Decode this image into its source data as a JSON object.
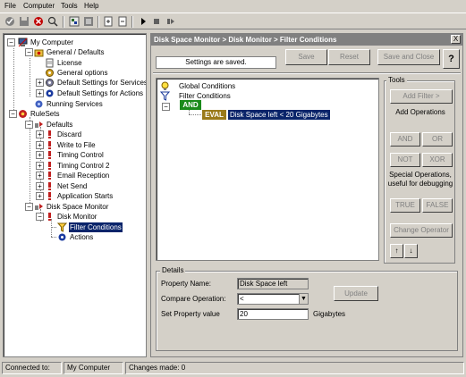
{
  "menu": {
    "file": "File",
    "computer": "Computer",
    "tools": "Tools",
    "help": "Help"
  },
  "toolbar": {
    "icons": [
      "check-icon",
      "save-icon",
      "delete-icon",
      "search-icon",
      "tree-icon",
      "print-icon",
      "export-icon",
      "import-icon",
      "play-icon",
      "stop-icon",
      "step-icon"
    ]
  },
  "tree": {
    "root": "My Computer",
    "general": "General / Defaults",
    "license": "License",
    "general_options": "General options",
    "default_services": "Default Settings for Services",
    "default_actions": "Default Settings for Actions",
    "running_services": "Running Services",
    "rulesets": "RuleSets",
    "defaults": "Defaults",
    "discard": "Discard",
    "write_file": "Write to File",
    "timing1": "Timing Control",
    "timing2": "Timing Control 2",
    "email": "Email Reception",
    "netsend": "Net Send",
    "appstarts": "Application Starts",
    "dsm": "Disk Space Monitor",
    "disk_monitor": "Disk Monitor",
    "filter_conditions": "Filter Conditions",
    "actions": "Actions"
  },
  "panel": {
    "title": "Disk Space Monitor > Disk Monitor > Filter Conditions",
    "close": "X",
    "status": "Settings are saved.",
    "save": "Save",
    "reset": "Reset",
    "save_close": "Save and Close",
    "help": "?"
  },
  "conditions": {
    "global": "Global Conditions",
    "filter": "Filter Conditions",
    "and_tag": "AND",
    "eval_tag": "EVAL",
    "eval_text": "Disk Space left < 20 Gigabytes"
  },
  "tools": {
    "label": "Tools",
    "add_filter": "Add Filter >",
    "add_operations": "Add Operations",
    "and": "AND",
    "or": "OR",
    "not": "NOT",
    "xor": "XOR",
    "special_line1": "Special Operations,",
    "special_line2": "useful for debugging",
    "true": "TRUE",
    "false": "FALSE",
    "change_operator": "Change Operator",
    "up": "↑",
    "down": "↓"
  },
  "details": {
    "label": "Details",
    "property_name_label": "Property Name:",
    "property_name_value": "Disk Space left",
    "compare_label": "Compare Operation:",
    "compare_value": "<",
    "set_label": "Set Property value",
    "set_value": "20",
    "unit": "Gigabytes",
    "update": "Update"
  },
  "statusbar": {
    "connected_label": "Connected to:",
    "connected_value": "My Computer",
    "changes": "Changes made: 0"
  }
}
